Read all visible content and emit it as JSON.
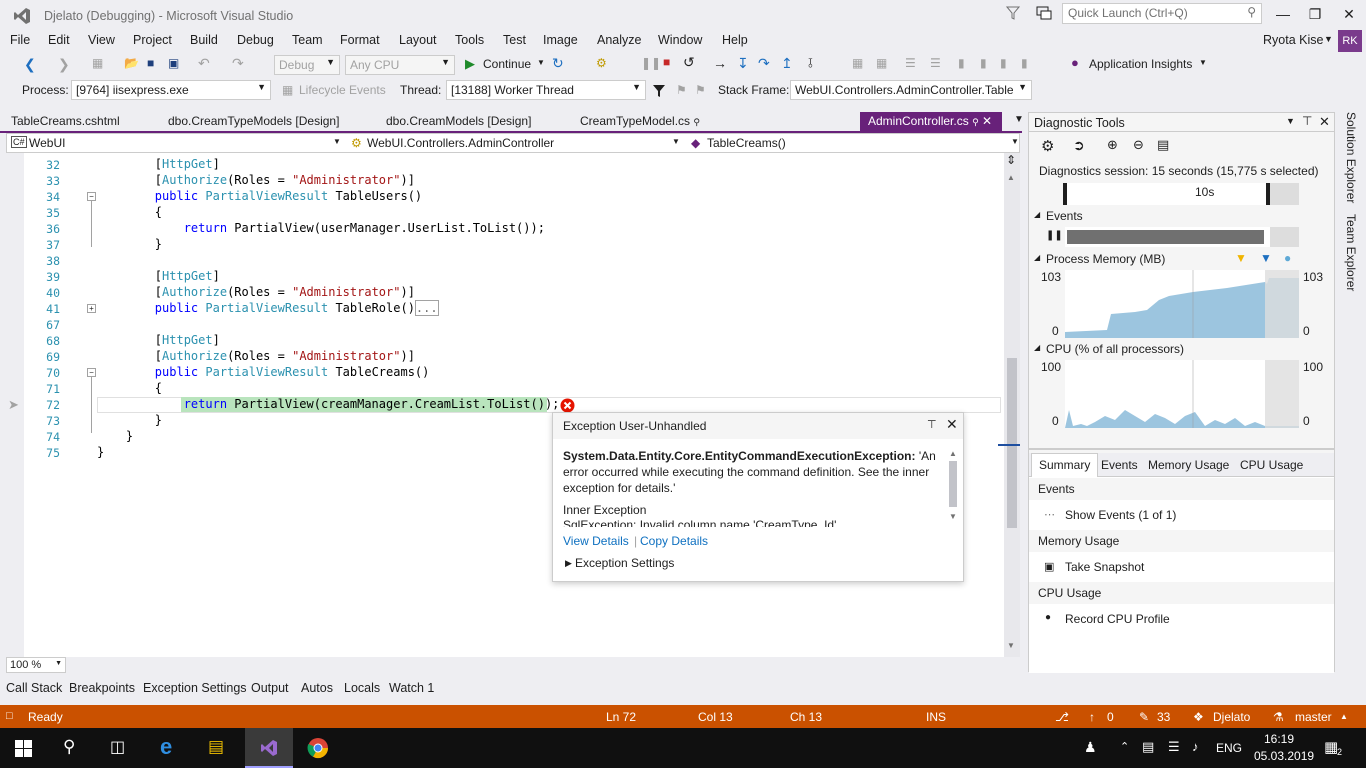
{
  "titlebar": {
    "title": "Djelato (Debugging) - Microsoft Visual Studio",
    "quick_launch": "Quick Launch (Ctrl+Q)"
  },
  "menu": [
    "File",
    "Edit",
    "View",
    "Project",
    "Build",
    "Debug",
    "Team",
    "Format",
    "Layout",
    "Tools",
    "Test",
    "Image",
    "Analyze",
    "Window",
    "Help"
  ],
  "user": {
    "name": "Ryota Kise",
    "initials": "RK"
  },
  "toolbar": {
    "config": "Debug",
    "platform": "Any CPU",
    "continue": "Continue",
    "app_insights": "Application Insights"
  },
  "debug_location": {
    "process_label": "Process:",
    "process": "[9764] iisexpress.exe",
    "lifecycle": "Lifecycle Events",
    "thread_label": "Thread:",
    "thread": "[13188] Worker Thread",
    "stack_label": "Stack Frame:",
    "stack": "WebUI.Controllers.AdminController.Table"
  },
  "tabs": [
    {
      "label": "TableCreams.cshtml"
    },
    {
      "label": "dbo.CreamTypeModels [Design]"
    },
    {
      "label": "dbo.CreamModels [Design]"
    },
    {
      "label": "CreamTypeModel.cs"
    },
    {
      "label": "AdminController.cs"
    }
  ],
  "nav": {
    "project": "WebUI",
    "class": "WebUI.Controllers.AdminController",
    "member": "TableCreams()"
  },
  "code": {
    "line_numbers": [
      "32",
      "33",
      "34",
      "35",
      "36",
      "37",
      "38",
      "39",
      "40",
      "41",
      "67",
      "68",
      "69",
      "70",
      "71",
      "72",
      "73",
      "74",
      "75"
    ]
  },
  "exception": {
    "title": "Exception User-Unhandled",
    "type": "System.Data.Entity.Core.EntityCommandExecutionException:",
    "message": " 'An error occurred while executing the command definition. See the inner exception for details.'",
    "inner_label": "Inner Exception",
    "inner": "SqlException: Invalid column name 'CreamType_Id'",
    "view_details": "View Details",
    "copy_details": "Copy Details",
    "settings": "Exception Settings"
  },
  "zoom": "100 %",
  "bottom_tabs": [
    "Call Stack",
    "Breakpoints",
    "Exception Settings",
    "Output",
    "Autos",
    "Locals",
    "Watch 1"
  ],
  "status": {
    "ready": "Ready",
    "ln": "Ln 72",
    "col": "Col 13",
    "ch": "Ch 13",
    "ins": "INS",
    "up": "0",
    "pencil": "33",
    "repo": "Djelato",
    "branch": "master"
  },
  "diagnostics": {
    "title": "Diagnostic Tools",
    "session": "Diagnostics session: 15 seconds (15,775 s selected)",
    "tick": "10s",
    "events_label": "Events",
    "memory_label": "Process Memory (MB)",
    "memory_max": "103",
    "memory_min": "0",
    "cpu_label": "CPU (% of all processors)",
    "cpu_max": "100",
    "cpu_min": "0",
    "tabs": [
      "Summary",
      "Events",
      "Memory Usage",
      "CPU Usage"
    ],
    "sections": [
      {
        "header": "Events",
        "item": "Show Events (1 of 1)"
      },
      {
        "header": "Memory Usage",
        "item": "Take Snapshot"
      },
      {
        "header": "CPU Usage",
        "item": "Record CPU Profile"
      }
    ]
  },
  "side_tabs": [
    "Solution Explorer",
    "Team Explorer"
  ],
  "taskbar": {
    "time": "16:19",
    "date": "05.03.2019",
    "lang": "ENG",
    "notif": "2"
  }
}
